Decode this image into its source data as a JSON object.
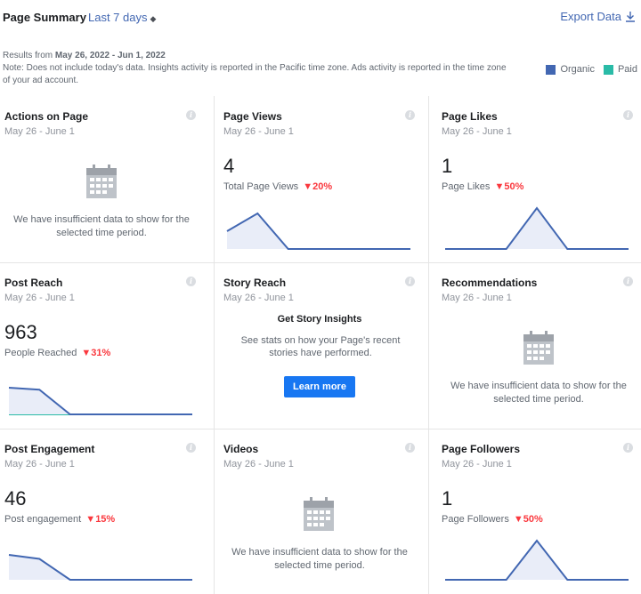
{
  "header": {
    "title": "Page Summary",
    "date_range": "Last 7 days",
    "export_label": "Export Data"
  },
  "results": {
    "prefix": "Results from",
    "range": "May 26, 2022 - Jun 1, 2022"
  },
  "note": "Note: Does not include today's data. Insights activity is reported in the Pacific time zone. Ads activity is reported in the time zone of your ad account.",
  "legend": [
    {
      "label": "Organic",
      "color": "#4267b2"
    },
    {
      "label": "Paid",
      "color": "#2abba7"
    }
  ],
  "cards": {
    "actions": {
      "title": "Actions on Page",
      "date": "May 26 - June 1",
      "message": "We have insufficient data to show for the selected time period."
    },
    "page_views": {
      "title": "Page Views",
      "date": "May 26 - June 1",
      "value": "4",
      "label": "Total Page Views",
      "change": "20%"
    },
    "page_likes": {
      "title": "Page Likes",
      "date": "May 26 - June 1",
      "value": "1",
      "label": "Page Likes",
      "change": "50%"
    },
    "post_reach": {
      "title": "Post Reach",
      "date": "May 26 - June 1",
      "value": "963",
      "label": "People Reached",
      "change": "31%"
    },
    "story_reach": {
      "title": "Story Reach",
      "date": "May 26 - June 1",
      "heading": "Get Story Insights",
      "desc": "See stats on how your Page's recent stories have performed.",
      "button": "Learn more"
    },
    "recommendations": {
      "title": "Recommendations",
      "date": "May 26 - June 1",
      "message": "We have insufficient data to show for the selected time period."
    },
    "post_engagement": {
      "title": "Post Engagement",
      "date": "May 26 - June 1",
      "value": "46",
      "label": "Post engagement",
      "change": "15%"
    },
    "videos": {
      "title": "Videos",
      "date": "May 26 - June 1",
      "message": "We have insufficient data to show for the selected time period."
    },
    "page_followers": {
      "title": "Page Followers",
      "date": "May 26 - June 1",
      "value": "1",
      "label": "Page Followers",
      "change": "50%"
    }
  },
  "sparklines": {
    "page_views": {
      "organic": [
        1,
        2,
        0,
        0,
        0,
        0,
        0
      ]
    },
    "page_likes": {
      "organic": [
        0,
        0,
        0,
        1,
        0,
        0,
        0
      ]
    },
    "post_reach": {
      "organic": [
        500,
        463,
        0,
        0,
        0,
        0,
        0
      ],
      "paid": [
        0,
        0,
        0,
        0,
        0,
        0,
        0
      ]
    },
    "post_engagement": {
      "organic": [
        25,
        21,
        0,
        0,
        0,
        0,
        0
      ]
    },
    "page_followers": {
      "organic": [
        0,
        0,
        0,
        1,
        0,
        0,
        0
      ]
    }
  }
}
